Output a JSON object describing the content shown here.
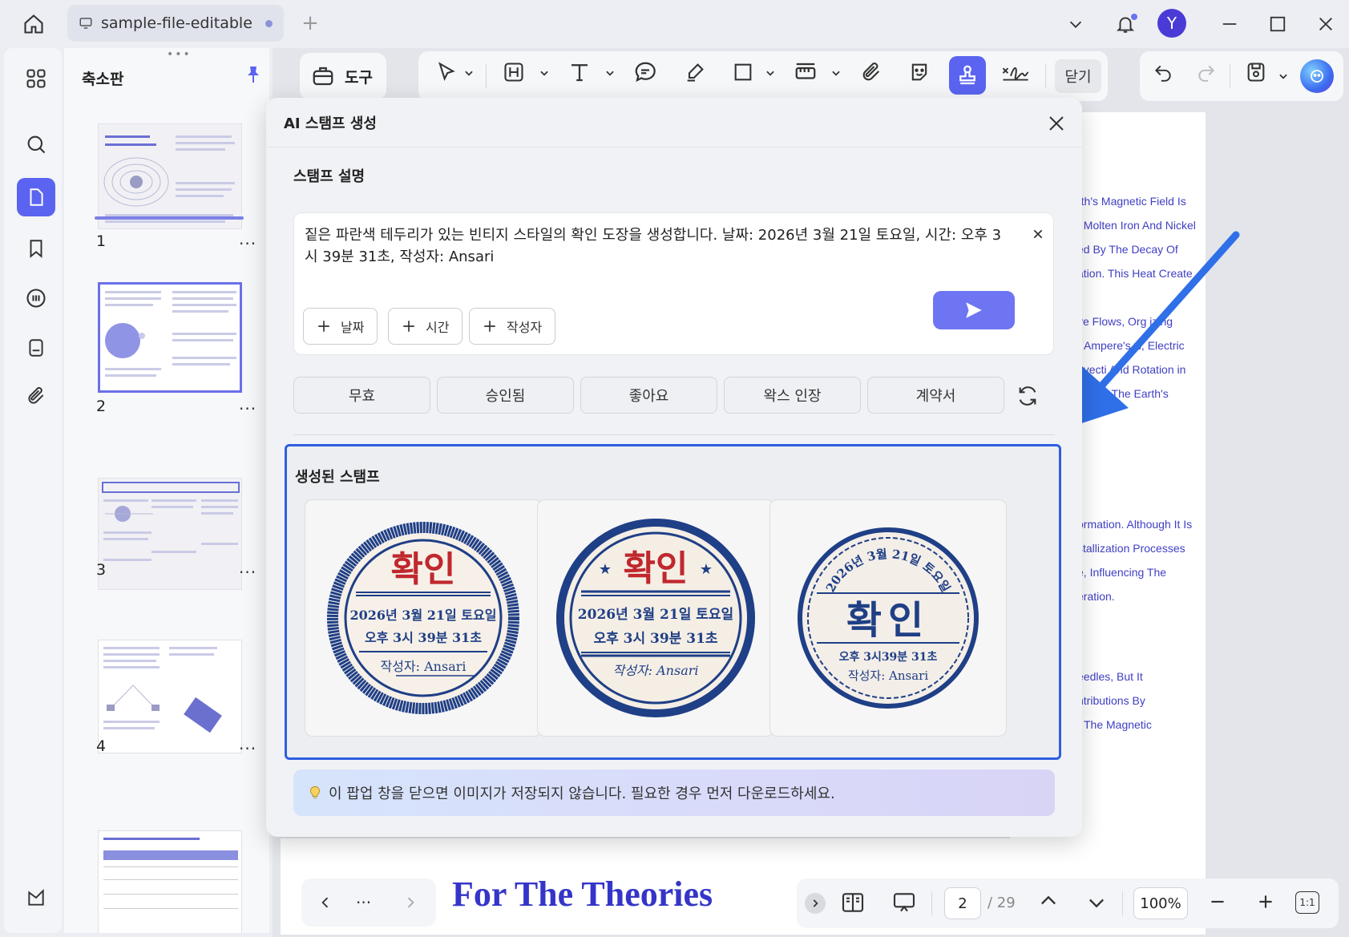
{
  "titlebar": {
    "tab_name": "sample-file-editable",
    "avatar_letter": "Y"
  },
  "thumbnails": {
    "title": "축소판",
    "pages": [
      {
        "number": "1",
        "more": "..."
      },
      {
        "number": "2",
        "more": "..."
      },
      {
        "number": "3",
        "more": "..."
      },
      {
        "number": "4",
        "more": "..."
      }
    ]
  },
  "toolbar": {
    "tools_label": "도구",
    "close_label": "닫기"
  },
  "document": {
    "right_column_lines": [
      "rth's Magnetic Field Is",
      "f Molten Iron And Nickel",
      "ed By The Decay Of",
      "ation. This Heat Create",
      "ve Flows, Org   izing",
      "Ampere's   w, Electric",
      "avecti   And Rotation in",
      "erates The Earth's",
      "ormation. Although It Is",
      "stallization Processes",
      "e, Influencing The",
      "eration.",
      "eedles, But It",
      "ntributions By",
      "The Magnetic"
    ],
    "bottom_heading": "For The Theories"
  },
  "modal": {
    "title": "AI 스탬프 생성",
    "description_label": "스탬프 설명",
    "description_text": "짙은 파란색 테두리가 있는 빈티지 스타일의 확인 도장을 생성합니다. 날짜: 2026년 3월 21일 토요일, 시간: 오후 3시 39분 31초, 작성자: Ansari",
    "chips": [
      {
        "label": "날짜"
      },
      {
        "label": "시간"
      },
      {
        "label": "작성자"
      }
    ],
    "presets": [
      "무효",
      "승인됨",
      "좋아요",
      "왁스 인장",
      "계약서"
    ],
    "generated_label": "생성된 스탬프",
    "stamps": [
      {
        "title": "확인",
        "date": "2026년 3월 21일 토요일",
        "time": "오후 3시 39분 31초",
        "author": "작성자: Ansari"
      },
      {
        "title": "확인",
        "date": "2026년 3월 21일 토요일",
        "time": "오후 3시 39분 31초",
        "author": "작성자: Ansari"
      },
      {
        "title": "확인",
        "date": "2026년 3월 21일 토요일",
        "time": "오후 3시39분 31초",
        "author": "작성자: Ansari"
      }
    ],
    "notice": "이 팝업 창을 닫으면 이미지가 저장되지 않습니다. 필요한 경우 먼저 다운로드하세요."
  },
  "footer": {
    "nav_more": "...",
    "current_page": "2",
    "total_pages": "/ 29",
    "zoom": "100%",
    "fit_label": "1:1"
  },
  "colors": {
    "accent": "#5b64f0",
    "stamp_blue": "#1f3f86",
    "stamp_red": "#c0282e",
    "highlight_border": "#2e5ee0",
    "arrow": "#2f6fe8"
  }
}
